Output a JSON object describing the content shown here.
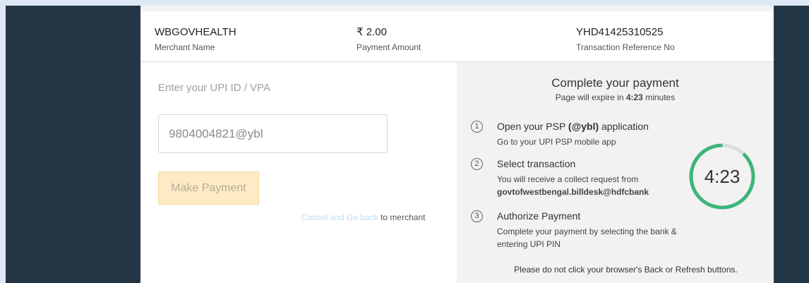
{
  "header": {
    "merchant_name": "WBGOVHEALTH",
    "merchant_label": "Merchant Name",
    "amount": "₹ 2.00",
    "amount_label": "Payment Amount",
    "txn_ref": "YHD41425310525",
    "txn_ref_label": "Transaction Reference No"
  },
  "form": {
    "upi_label": "Enter your UPI ID / VPA",
    "upi_value": "9804004821@ybl",
    "pay_button": "Make Payment",
    "cancel_link": "Cancel and Go back",
    "cancel_suffix": " to merchant"
  },
  "instructions": {
    "title": "Complete your payment",
    "expire_prefix": "Page will expire in ",
    "expire_time": "4:23",
    "expire_suffix": " minutes",
    "steps": [
      {
        "num": "1",
        "title_prefix": "Open your PSP ",
        "title_bold": "(@ybl)",
        "title_suffix": " application",
        "desc": "Go to your UPI PSP mobile app"
      },
      {
        "num": "2",
        "title": "Select transaction",
        "desc": "You will receive a collect request from",
        "desc_bold": "govtofwestbengal.billdesk@hdfcbank"
      },
      {
        "num": "3",
        "title": "Authorize Payment",
        "desc": "Complete your payment by selecting the bank & entering UPI PIN"
      }
    ],
    "footnote": "Please do not click your browser's Back or Refresh buttons."
  },
  "timer": {
    "display": "4:23",
    "remaining_fraction": 0.88,
    "ring_color": "#3db57a",
    "track_color": "#dcdcdc"
  }
}
